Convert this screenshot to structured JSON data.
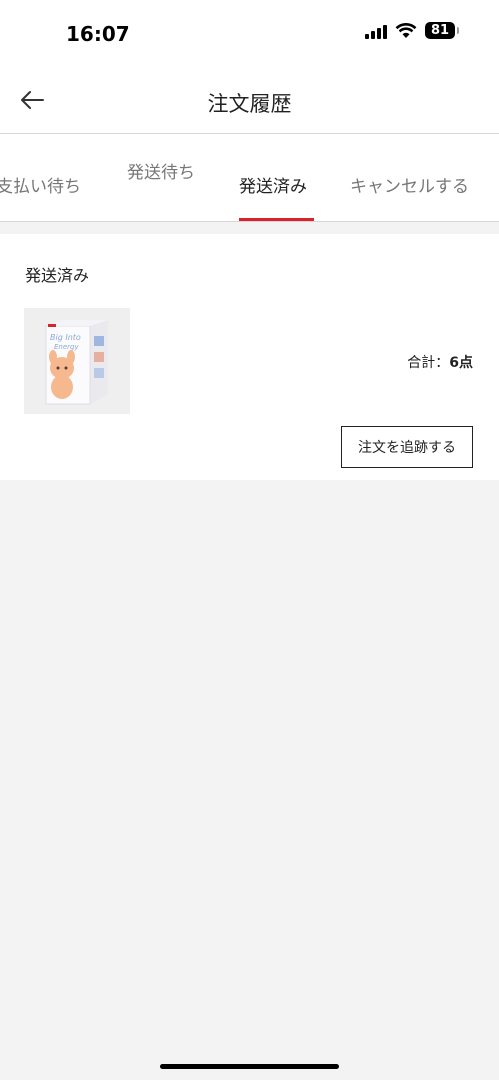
{
  "status_bar": {
    "time": "16:07",
    "battery": "81"
  },
  "header": {
    "title": "注文履歴",
    "back_icon": "arrow-left-icon"
  },
  "tabs": [
    {
      "label": "支払い待ち",
      "active": false
    },
    {
      "label": "発送待ち",
      "active": false
    },
    {
      "label": "発送済み",
      "active": true
    },
    {
      "label": "キャンセルする",
      "active": false
    }
  ],
  "order": {
    "status": "発送済み",
    "total_label": "合計：",
    "total_count": "6点",
    "track_button": "注文を追跡する"
  },
  "colors": {
    "accent": "#d8232a",
    "background": "#f3f3f3"
  }
}
